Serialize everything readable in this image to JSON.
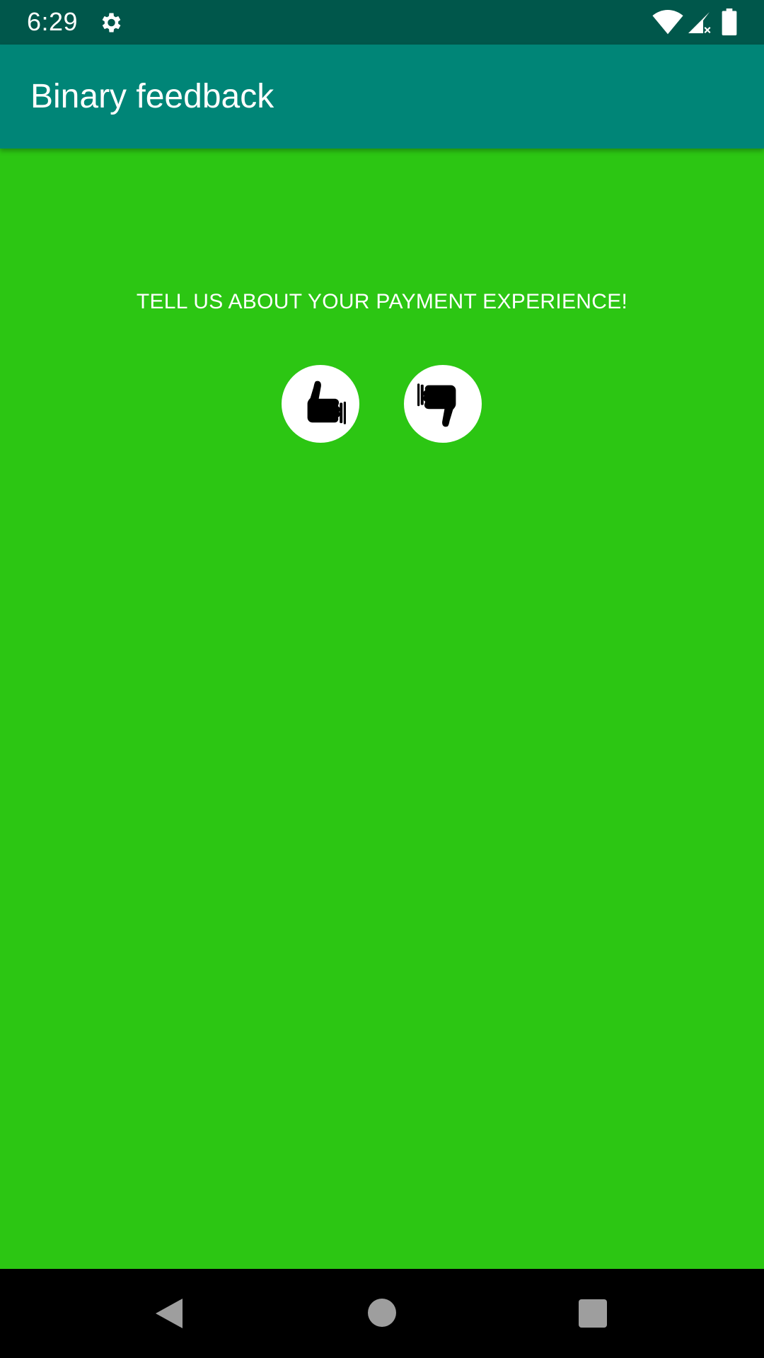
{
  "status_bar": {
    "time": "6:29",
    "icons": [
      "gear-icon",
      "wifi-icon",
      "signal-icon",
      "battery-icon"
    ]
  },
  "app_bar": {
    "title": "Binary feedback"
  },
  "main": {
    "prompt": "TELL US ABOUT YOUR PAYMENT EXPERIENCE!",
    "buttons": [
      {
        "icon": "thumbs-up-icon"
      },
      {
        "icon": "thumbs-down-icon"
      }
    ]
  },
  "nav_bar": {
    "icons": [
      "back-icon",
      "home-icon",
      "recents-icon"
    ]
  },
  "colors": {
    "background": "#2cc613",
    "app_bar": "#008577",
    "status_bar": "#00574b",
    "button": "#ffffff"
  }
}
